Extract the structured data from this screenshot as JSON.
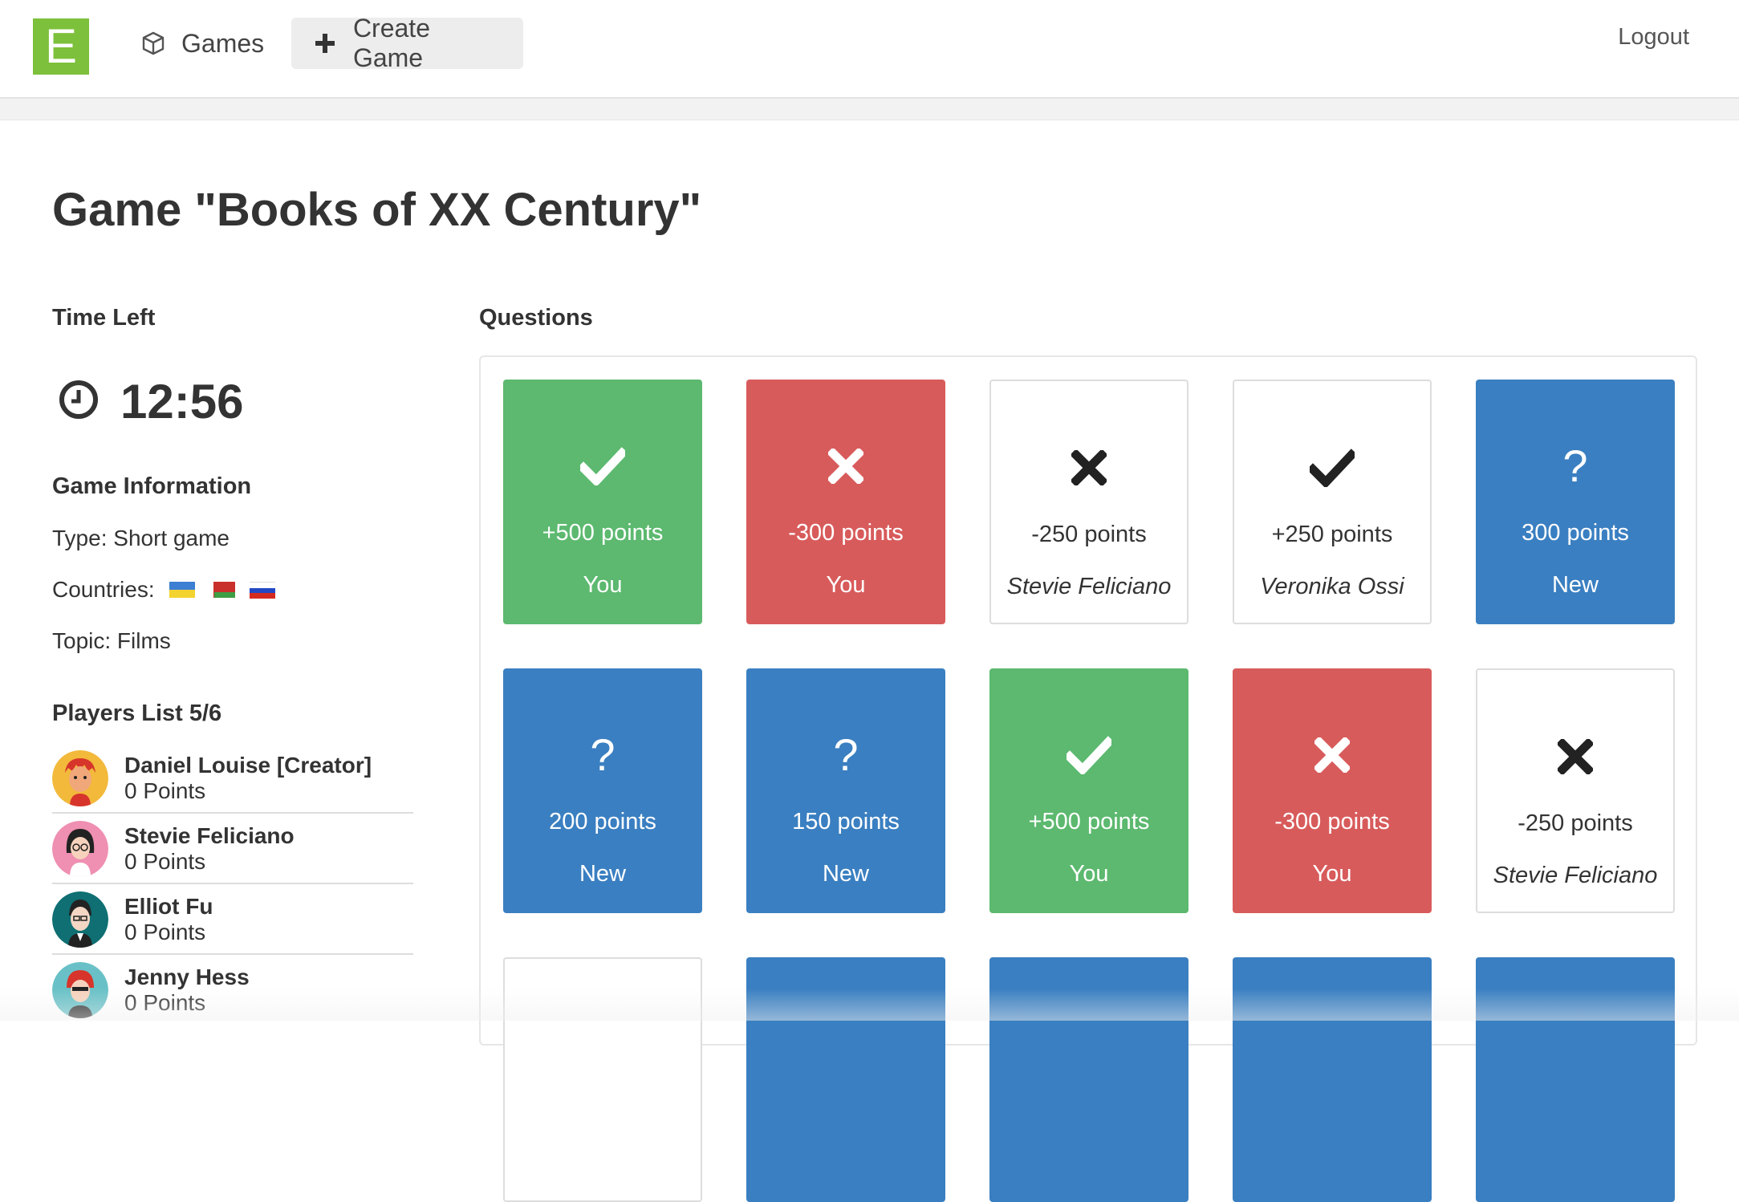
{
  "nav": {
    "logo_letter": "E",
    "games_label": "Games",
    "create_label": "Create Game",
    "logout_label": "Logout"
  },
  "page": {
    "title": "Game \"Books of XX Century\""
  },
  "time_left": {
    "heading": "Time Left",
    "value": "12:56"
  },
  "game_info": {
    "heading": "Game Information",
    "type": "Type: Short game",
    "countries_label": "Countries:",
    "countries": [
      "ukraine-flag",
      "belarus-flag",
      "russia-flag"
    ],
    "topic": "Topic: Films"
  },
  "players": {
    "heading": "Players List 5/6",
    "items": [
      {
        "name": "Daniel Louise [Creator]",
        "points": "0 Points",
        "avatar_color": "#f2b93b"
      },
      {
        "name": "Stevie Feliciano",
        "points": "0 Points",
        "avatar_color": "#ef8fb1"
      },
      {
        "name": "Elliot Fu",
        "points": "0 Points",
        "avatar_color": "#0f6f73"
      },
      {
        "name": "Jenny Hess",
        "points": "0 Points",
        "avatar_color": "#69c1c7"
      }
    ]
  },
  "questions": {
    "heading": "Questions",
    "tiles": [
      {
        "points": "+500 points",
        "owner": "You",
        "status": "correct",
        "style": "green"
      },
      {
        "points": "-300 points",
        "owner": "You",
        "status": "wrong",
        "style": "red"
      },
      {
        "points": "-250 points",
        "owner": "Stevie Feliciano",
        "status": "wrong",
        "style": "white"
      },
      {
        "points": "+250 points",
        "owner": "Veronika Ossi",
        "status": "correct",
        "style": "white"
      },
      {
        "points": "300 points",
        "owner": "New",
        "status": "new",
        "style": "blue"
      },
      {
        "points": "200 points",
        "owner": "New",
        "status": "new",
        "style": "blue"
      },
      {
        "points": "150 points",
        "owner": "New",
        "status": "new",
        "style": "blue"
      },
      {
        "points": "+500 points",
        "owner": "You",
        "status": "correct",
        "style": "green"
      },
      {
        "points": "-300 points",
        "owner": "You",
        "status": "wrong",
        "style": "red"
      },
      {
        "points": "-250 points",
        "owner": "Stevie Feliciano",
        "status": "wrong",
        "style": "white"
      },
      {
        "points": "",
        "owner": "",
        "status": "",
        "style": "white"
      },
      {
        "points": "",
        "owner": "",
        "status": "",
        "style": "blue"
      },
      {
        "points": "",
        "owner": "",
        "status": "",
        "style": "blue"
      },
      {
        "points": "",
        "owner": "",
        "status": "",
        "style": "blue"
      },
      {
        "points": "",
        "owner": "",
        "status": "",
        "style": "blue"
      }
    ]
  },
  "colors": {
    "logo": "#7dc03b",
    "correct": "#5cb96f",
    "wrong": "#d85b5b",
    "new": "#3a7fc1"
  }
}
